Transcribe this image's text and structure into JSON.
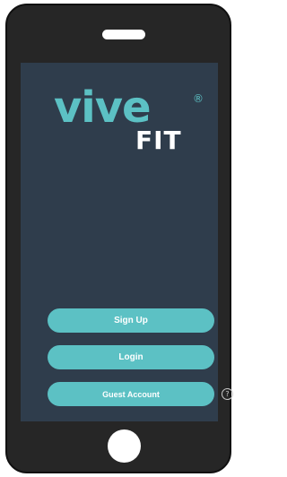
{
  "logo": {
    "wordmark": "vive",
    "registered": "®",
    "sub": "FIT"
  },
  "buttons": {
    "sign_up": "Sign Up",
    "login": "Login",
    "guest_account": "Guest Account"
  },
  "help": {
    "glyph": "?"
  },
  "colors": {
    "accent": "#5cc1c4",
    "screen_bg": "#2f3d4c",
    "phone_body": "#262626"
  },
  "icons": [
    "question-circle-icon",
    "speaker-slot",
    "home-button"
  ]
}
